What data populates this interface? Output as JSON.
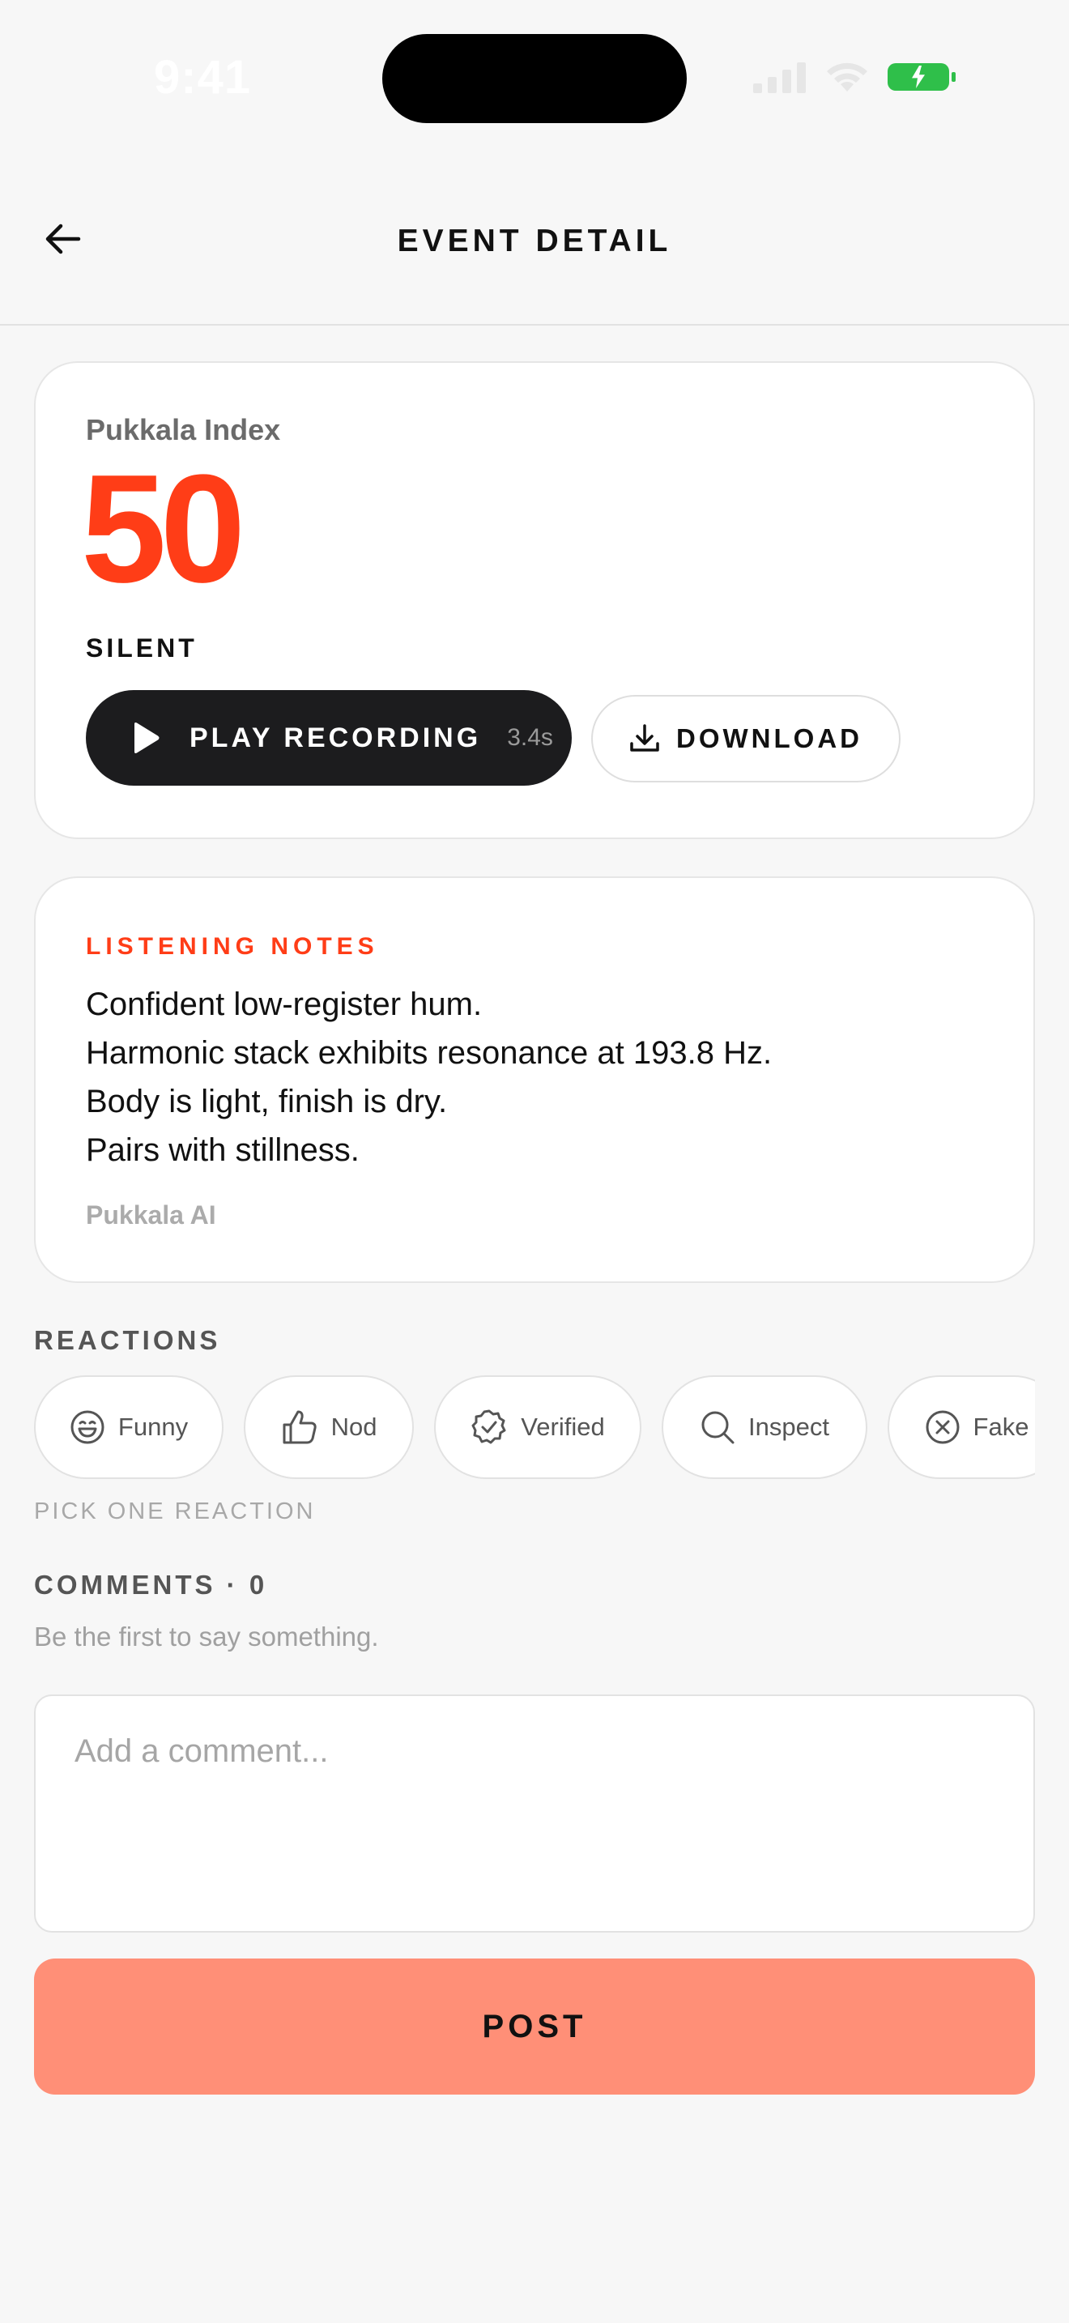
{
  "status_bar": {
    "time": "9:41",
    "icons": [
      "signal-icon",
      "wifi-icon",
      "battery-charging-icon"
    ],
    "battery_color": "#2fbf4a"
  },
  "header": {
    "title": "EVENT DETAIL",
    "back_icon": "arrow-left-icon"
  },
  "index_card": {
    "label": "Pukkala Index",
    "value": "50",
    "value_color": "#ff3d17",
    "state": "SILENT",
    "play": {
      "label": "PLAY RECORDING",
      "duration": "3.4s",
      "icon": "play-icon"
    },
    "download": {
      "label": "DOWNLOAD",
      "icon": "download-icon"
    }
  },
  "notes_card": {
    "heading": "LISTENING NOTES",
    "lines": [
      "Confident low-register hum.",
      "Harmonic stack exhibits resonance at 193.8 Hz.",
      "Body is light, finish is dry.",
      "Pairs with stillness."
    ],
    "author": "Pukkala AI"
  },
  "reactions": {
    "label": "REACTIONS",
    "items": [
      {
        "label": "Funny",
        "icon": "laughing-face-icon"
      },
      {
        "label": "Nod",
        "icon": "thumbs-up-icon"
      },
      {
        "label": "Verified",
        "icon": "verified-badge-icon"
      },
      {
        "label": "Inspect",
        "icon": "magnifier-icon"
      },
      {
        "label": "Fake",
        "icon": "x-circle-icon"
      }
    ],
    "hint": "PICK ONE REACTION"
  },
  "comments": {
    "label": "COMMENTS · 0",
    "empty_text": "Be the first to say something.",
    "input_placeholder": "Add a comment...",
    "input_value": "",
    "post_label": "POST",
    "post_color": "#ff8f77"
  }
}
